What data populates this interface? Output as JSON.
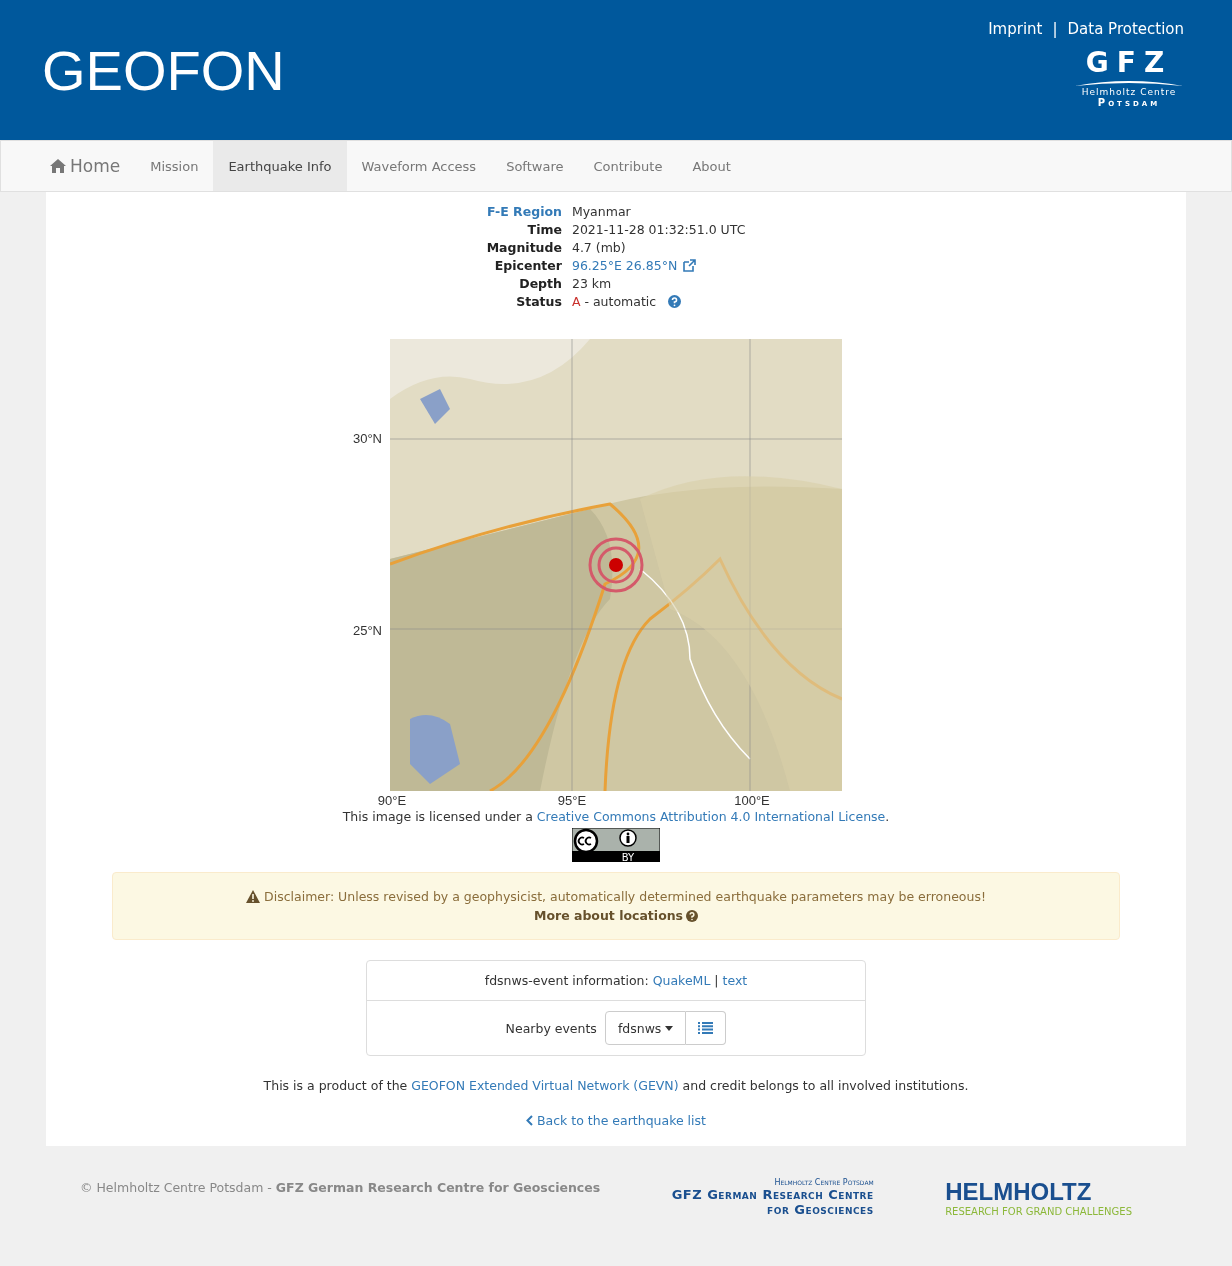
{
  "header": {
    "title": "GEOFON",
    "links": [
      "Imprint",
      "Data Protection"
    ],
    "separator": "|",
    "logo": {
      "mark": "GFZ",
      "line1": "Helmholtz Centre",
      "line2": "Potsdam"
    }
  },
  "nav": [
    {
      "label": "Home",
      "kind": "home",
      "selected": false
    },
    {
      "label": "Mission",
      "kind": "link",
      "selected": false
    },
    {
      "label": "Earthquake Info",
      "kind": "link",
      "selected": true
    },
    {
      "label": "Waveform Access",
      "kind": "link",
      "selected": false
    },
    {
      "label": "Software",
      "kind": "link",
      "selected": false
    },
    {
      "label": "Contribute",
      "kind": "link",
      "selected": false
    },
    {
      "label": "About",
      "kind": "link",
      "selected": false
    }
  ],
  "event": [
    {
      "label": "F-E Region",
      "value": "Myanmar",
      "kind": "region"
    },
    {
      "label": "Time",
      "value": "2021-11-28 01:32:51.0 UTC",
      "kind": "plain"
    },
    {
      "label": "Magnitude",
      "value": "4.7 (mb)",
      "kind": "plain"
    },
    {
      "label": "Epicenter",
      "value": "96.25°E 26.85°N",
      "kind": "external"
    },
    {
      "label": "Depth",
      "value": "23 km",
      "kind": "plain"
    },
    {
      "label": "Status",
      "code": "A",
      "value": " - automatic",
      "kind": "status"
    }
  ],
  "map": {
    "kind": "picture",
    "yticks": [
      "30°N",
      "25°N"
    ],
    "xticks": [
      "90°E",
      "95°E",
      "100°E"
    ]
  },
  "license": {
    "before": "This image is licensed under a ",
    "link": "Creative Commons Attribution 4.0 International License",
    "after": ".",
    "badge": "BY"
  },
  "disclaimer": {
    "text": "Disclaimer: Unless revised by a geophysicist, automatically determined earthquake parameters may be erroneous!",
    "link": "More about locations"
  },
  "info_panel": {
    "label": "fdsnws-event information: ",
    "links": [
      "QuakeML",
      "text"
    ],
    "separator": "|",
    "nearby_label": "Nearby events",
    "dropdown": "fdsnws"
  },
  "credit": {
    "before": "This is a product of the ",
    "link": "GEOFON Extended Virtual Network (GEVN)",
    "after": " and credit belongs to all involved institutions."
  },
  "back_link": "Back to the earthquake list",
  "footer": {
    "copyright": "© Helmholtz Centre Potsdam - **GFZ German Research Centre for Geosciences**",
    "gfz_logo": [
      "Helmholtz Centre Potsdam",
      "GFZ German Research Centre",
      "for Geosciences"
    ],
    "helmholtz_logo": [
      "HELMHOLTZ",
      "RESEARCH FOR GRAND CHALLENGES"
    ]
  }
}
